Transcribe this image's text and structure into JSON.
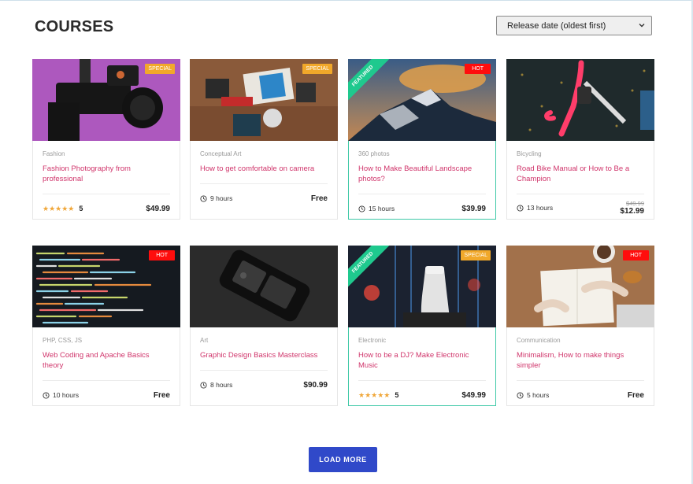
{
  "page": {
    "title": "COURSES"
  },
  "sort": {
    "selected": "Release date (oldest first)"
  },
  "load_more": {
    "label": "LOAD MORE"
  },
  "courses": [
    {
      "category": "Fashion",
      "title": "Fashion Photography from professional",
      "badge": "SPECIAL",
      "rating_stars": "★★★★★",
      "rating": "5",
      "price": "$49.99"
    },
    {
      "category": "Conceptual Art",
      "title": "How to get comfortable on camera",
      "badge": "SPECIAL",
      "hours": "9 hours",
      "price": "Free"
    },
    {
      "category": "360 photos",
      "title": "How to Make Beautiful Landscape photos?",
      "badge": "HOT",
      "ribbon": "FEATURED",
      "hours": "15 hours",
      "price": "$39.99"
    },
    {
      "category": "Bicycling",
      "title": "Road Bike Manual or How to Be a Champion",
      "hours": "13 hours",
      "old_price": "$49.99",
      "price": "$12.99"
    },
    {
      "category": "PHP, CSS, JS",
      "title": "Web Coding and Apache Basics theory",
      "badge": "HOT",
      "hours": "10 hours",
      "price": "Free"
    },
    {
      "category": "Art",
      "title": "Graphic Design Basics Masterclass",
      "hours": "8 hours",
      "price": "$90.99"
    },
    {
      "category": "Electronic",
      "title": "How to be a DJ? Make Electronic Music",
      "badge": "SPECIAL",
      "ribbon": "FEATURED",
      "rating_stars": "★★★★★",
      "rating": "5",
      "price": "$49.99"
    },
    {
      "category": "Communication",
      "title": "Minimalism, How to make things simpler",
      "badge": "HOT",
      "hours": "5 hours",
      "price": "Free"
    }
  ],
  "colors": {
    "accent": "#d0356b",
    "featured": "#1fc98e",
    "hot": "#ff0d0d",
    "special": "#f1a82a",
    "button": "#3049c9"
  }
}
